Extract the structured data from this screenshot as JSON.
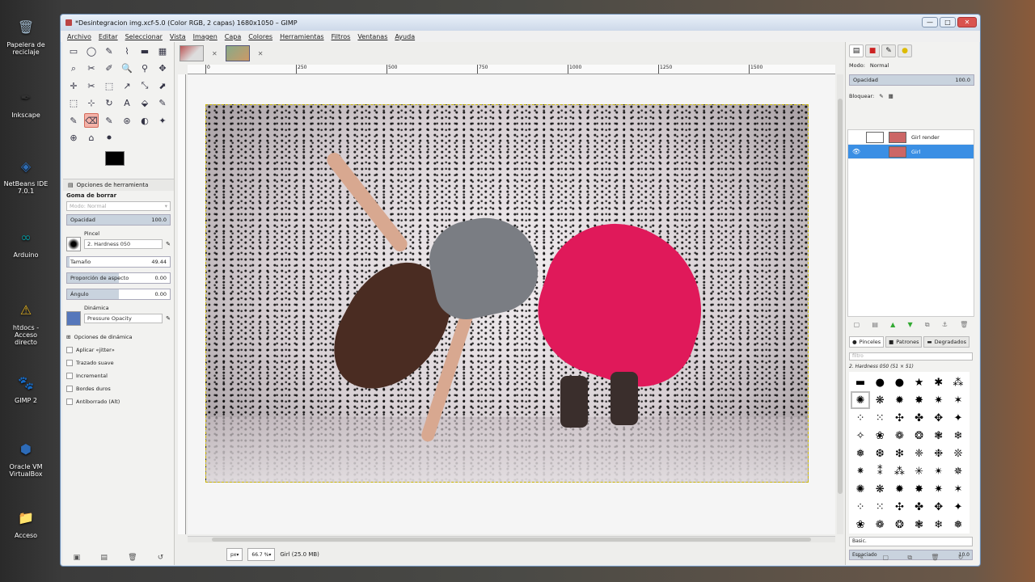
{
  "desktop": [
    {
      "label": "Papelera de reciclaje",
      "icon": "recycle-bin-icon",
      "glyph": "🗑",
      "color": "#9fb6c9"
    },
    {
      "label": "Inkscape",
      "icon": "inkscape-icon",
      "glyph": "✒",
      "color": "#333"
    },
    {
      "label": "NetBeans IDE 7.0.1",
      "icon": "netbeans-icon",
      "glyph": "◈",
      "color": "#2f6db5"
    },
    {
      "label": "Arduino",
      "icon": "arduino-icon",
      "glyph": "∞",
      "color": "#0a8f95"
    },
    {
      "label": "htdocs - Acceso directo",
      "icon": "warning-shortcut-icon",
      "glyph": "⚠",
      "color": "#e0b020"
    },
    {
      "label": "GIMP 2",
      "icon": "gimp-icon",
      "glyph": "🐾",
      "color": "#777"
    },
    {
      "label": "Oracle VM VirtualBox",
      "icon": "virtualbox-icon",
      "glyph": "⬢",
      "color": "#2d6bb8"
    },
    {
      "label": "Acceso",
      "icon": "folder-icon",
      "glyph": "📁",
      "color": "#e8c36a"
    }
  ],
  "window": {
    "title": "*Desintegracion img.xcf-5.0 (Color RGB, 2 capas) 1680x1050 – GIMP",
    "min": "—",
    "max": "□",
    "close": "✕"
  },
  "menu": [
    "Archivo",
    "Editar",
    "Seleccionar",
    "Vista",
    "Imagen",
    "Capa",
    "Colores",
    "Herramientas",
    "Filtros",
    "Ventanas",
    "Ayuda"
  ],
  "tools": [
    "▭",
    "◯",
    "✎",
    "⌇",
    "▬",
    "▦",
    "⌕",
    "✂",
    "✐",
    "🔍",
    "⚲",
    "✥",
    "✛",
    "✂",
    "⬚",
    "↗",
    "⤡",
    "⬈",
    "⬚",
    "⊹",
    "↻",
    "A",
    "⬙",
    "✎",
    "✎",
    "⌫",
    "✎",
    "⊛",
    "◐",
    "✦",
    "⊕",
    "⌂",
    "⚫"
  ],
  "tool_options": {
    "tab": "Opciones de herramienta",
    "title": "Goma de borrar",
    "mode_label": "Modo:",
    "mode_value": "Normal",
    "opacity_label": "Opacidad",
    "opacity_value": "100.0",
    "brush_label": "Pincel",
    "brush_value": "2. Hardness 050",
    "size_label": "Tamaño",
    "size_value": "49.44",
    "aspect_label": "Proporción de aspecto",
    "aspect_value": "0.00",
    "angle_label": "Ángulo",
    "angle_value": "0.00",
    "dynamics_label": "Dinámica",
    "dynamics_value": "Pressure Opacity",
    "dynamics_options": "Opciones de dinámica",
    "checks": [
      "Aplicar «jitter»",
      "Trazado suave",
      "Incremental",
      "Bordes duros",
      "Antiborrado  (Alt)"
    ]
  },
  "ruler": [
    "0",
    "250",
    "500",
    "750",
    "1000",
    "1250",
    "1500"
  ],
  "status": {
    "unit": "px",
    "zoom": "66.7 %",
    "info": "Girl (25.0 MB)"
  },
  "layers_panel": {
    "mode_label": "Modo:",
    "mode_value": "Normal",
    "opacity_label": "Opacidad",
    "opacity_value": "100.0",
    "lock_label": "Bloquear:",
    "layers": [
      {
        "name": "Girl render",
        "selected": false
      },
      {
        "name": "Girl",
        "selected": true
      }
    ]
  },
  "brushes_panel": {
    "tabs": [
      "Pinceles",
      "Patrones",
      "Degradados"
    ],
    "filter_placeholder": "filtro",
    "current": "2. Hardness 050 (51 × 51)",
    "set": "Basic.",
    "spacing_label": "Espaciado",
    "spacing_value": "10.0"
  }
}
